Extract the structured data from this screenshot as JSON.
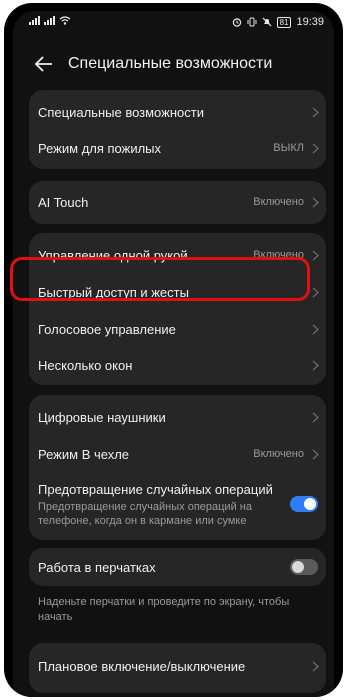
{
  "status_bar": {
    "time": "19:39",
    "battery": "81"
  },
  "header": {
    "title": "Специальные возможности"
  },
  "group1": {
    "accessibility": {
      "label": "Специальные возможности"
    },
    "elderly_mode": {
      "label": "Режим для пожилых",
      "value": "ВЫКЛ"
    }
  },
  "group2": {
    "ai_touch": {
      "label": "AI Touch",
      "value": "Включено"
    }
  },
  "group3": {
    "one_hand": {
      "label": "Управление одной рукой",
      "value": "Включено"
    },
    "quick_access": {
      "label": "Быстрый доступ и жесты"
    },
    "voice_control": {
      "label": "Голосовое управление"
    },
    "multi_window": {
      "label": "Несколько окон"
    }
  },
  "group4": {
    "digital_headphones": {
      "label": "Цифровые наушники"
    },
    "cover_mode": {
      "label": "Режим В чехле",
      "value": "Включено"
    },
    "accidental_ops": {
      "label": "Предотвращение случайных операций",
      "description": "Предотвращение случайных операций на телефоне, когда он в кармане или сумке",
      "enabled": true
    }
  },
  "group5": {
    "gloves": {
      "label": "Работа в перчатках",
      "enabled": false
    },
    "gloves_note": "Наденьте перчатки и проведите по экрану, чтобы начать"
  },
  "group6": {
    "scheduled_power": {
      "label": "Плановое включение/выключение"
    }
  },
  "colors": {
    "background": "#111111",
    "card": "#262626",
    "accent": "#2f7df6",
    "highlight": "#e11010"
  }
}
